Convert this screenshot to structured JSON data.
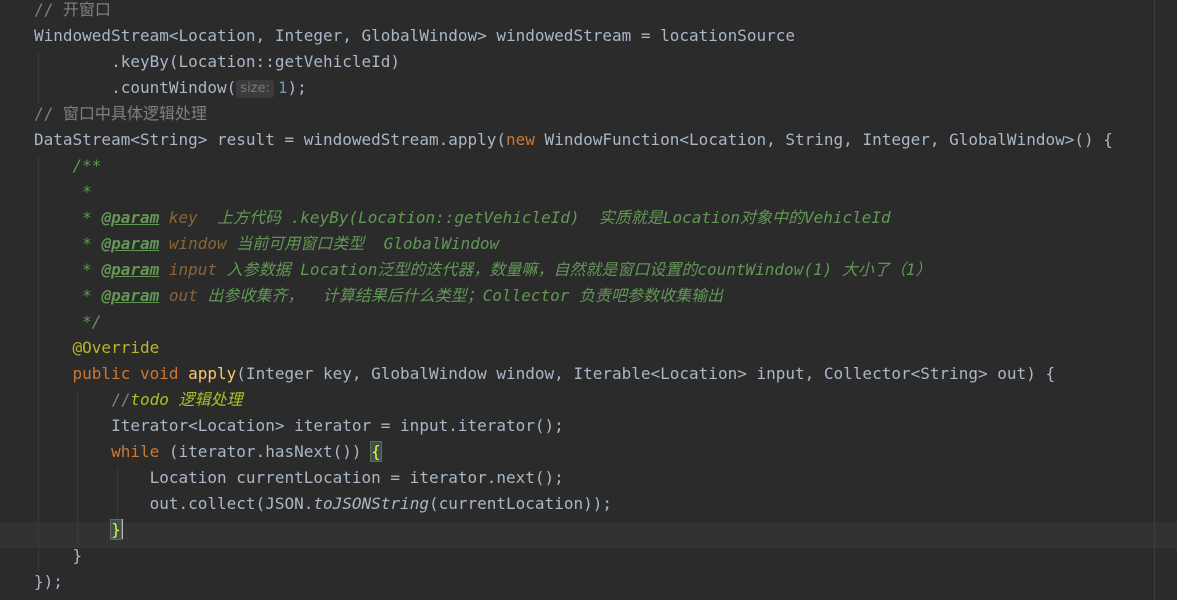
{
  "editor": {
    "lines": [
      {
        "tokens": [
          [
            "cmt",
            "// 开窗口"
          ]
        ]
      },
      {
        "tokens": [
          [
            "",
            "WindowedStream<Location, Integer, GlobalWindow> windowedStream = locationSource"
          ]
        ]
      },
      {
        "tokens": [
          [
            "",
            "        .keyBy(Location::getVehicleId)"
          ]
        ]
      },
      {
        "tokens": [
          [
            "",
            "        .countWindow("
          ],
          [
            "hint",
            "size:"
          ],
          [
            "num",
            "1"
          ],
          [
            "",
            ");"
          ]
        ]
      },
      {
        "tokens": [
          [
            "cmt",
            "// 窗口中具体逻辑处理"
          ]
        ]
      },
      {
        "tokens": [
          [
            "",
            "DataStream<String> result = windowedStream.apply("
          ],
          [
            "kw",
            "new"
          ],
          [
            "",
            " WindowFunction<Location, String, Integer, GlobalWindow>() {"
          ]
        ]
      },
      {
        "tokens": [
          [
            "doc",
            "    /**"
          ]
        ]
      },
      {
        "tokens": [
          [
            "doc",
            "     *"
          ]
        ]
      },
      {
        "tokens": [
          [
            "doc",
            "     * "
          ],
          [
            "doctag",
            "@param"
          ],
          [
            "docparam",
            " key"
          ],
          [
            "doc",
            "  上方代码 .keyBy(Location::getVehicleId)  实质就是Location对象中的VehicleId"
          ]
        ]
      },
      {
        "tokens": [
          [
            "doc",
            "     * "
          ],
          [
            "doctag",
            "@param"
          ],
          [
            "docparam",
            " window"
          ],
          [
            "doc",
            " 当前可用窗口类型  GlobalWindow"
          ]
        ]
      },
      {
        "tokens": [
          [
            "doc",
            "     * "
          ],
          [
            "doctag",
            "@param"
          ],
          [
            "docparam",
            " input"
          ],
          [
            "doc",
            " 入参数据 Location泛型的迭代器，数量嘛，自然就是窗口设置的countWindow(1) 大小了（1）"
          ]
        ]
      },
      {
        "tokens": [
          [
            "doc",
            "     * "
          ],
          [
            "doctag",
            "@param"
          ],
          [
            "docparam",
            " out"
          ],
          [
            "doc",
            " 出参收集齐，  计算结果后什么类型；Collector 负责吧参数收集输出"
          ]
        ]
      },
      {
        "tokens": [
          [
            "doc",
            "     */"
          ]
        ]
      },
      {
        "tokens": [
          [
            "ann",
            "    @Override"
          ]
        ]
      },
      {
        "tokens": [
          [
            "kw",
            "    public void "
          ],
          [
            "fn",
            "apply"
          ],
          [
            "",
            "(Integer key, GlobalWindow window, Iterable<Location> input, Collector<String> out) {"
          ]
        ]
      },
      {
        "tokens": [
          [
            "cmt",
            "        //"
          ],
          [
            "todo",
            "todo 逻辑处理"
          ]
        ]
      },
      {
        "tokens": [
          [
            "",
            "        Iterator<Location> iterator = input.iterator();"
          ]
        ]
      },
      {
        "tokens": [
          [
            "kw",
            "        while"
          ],
          [
            "",
            " (iterator.hasNext()) "
          ],
          [
            "brace",
            "{"
          ]
        ]
      },
      {
        "tokens": [
          [
            "",
            "            Location currentLocation = iterator.next();"
          ]
        ]
      },
      {
        "tokens": [
          [
            "",
            "            out.collect(JSON."
          ],
          [
            "static",
            "toJSONString"
          ],
          [
            "",
            "(currentLocation));"
          ]
        ]
      },
      {
        "tokens": [
          [
            "",
            "        "
          ],
          [
            "brace",
            "}"
          ],
          [
            "caret",
            ""
          ]
        ]
      },
      {
        "tokens": [
          [
            "",
            "    }"
          ]
        ]
      },
      {
        "tokens": [
          [
            "",
            "});"
          ]
        ]
      }
    ]
  }
}
